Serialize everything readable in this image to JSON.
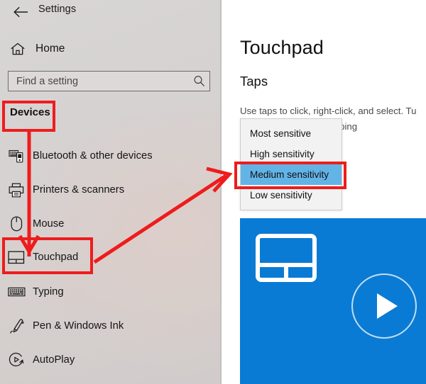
{
  "window": {
    "title": "Settings",
    "back_icon": "back-arrow-icon"
  },
  "sidebar": {
    "home": {
      "label": "Home",
      "icon": "home-icon"
    },
    "search": {
      "value": "",
      "placeholder": "Find a setting",
      "icon": "search-icon"
    },
    "section_header": "Devices",
    "items": [
      {
        "label": "Bluetooth & other devices",
        "icon": "bluetooth-devices-icon",
        "selected": false
      },
      {
        "label": "Printers & scanners",
        "icon": "printer-icon",
        "selected": false
      },
      {
        "label": "Mouse",
        "icon": "mouse-icon",
        "selected": false
      },
      {
        "label": "Touchpad",
        "icon": "touchpad-icon",
        "selected": true
      },
      {
        "label": "Typing",
        "icon": "keyboard-icon",
        "selected": false
      },
      {
        "label": "Pen & Windows Ink",
        "icon": "pen-icon",
        "selected": false
      },
      {
        "label": "AutoPlay",
        "icon": "autoplay-icon",
        "selected": false
      }
    ]
  },
  "main": {
    "page_title": "Touchpad",
    "section_title": "Taps",
    "description_line1": "Use taps to click, right-click, and select. Tu",
    "description_line2": "'re typing",
    "sensitivity_dropdown": {
      "selected": "Medium sensitivity",
      "options": [
        "Most sensitive",
        "High sensitivity",
        "Medium sensitivity",
        "Low sensitivity"
      ]
    },
    "video": {
      "play_icon": "play-button-icon",
      "thumbnail_icon": "touchpad-outline-icon",
      "background_color": "#0a7bd4"
    }
  },
  "annotations": {
    "color": "#ee1c1c",
    "boxes": [
      {
        "target": "Devices"
      },
      {
        "target": "Touchpad"
      },
      {
        "target": "Medium sensitivity"
      }
    ]
  }
}
